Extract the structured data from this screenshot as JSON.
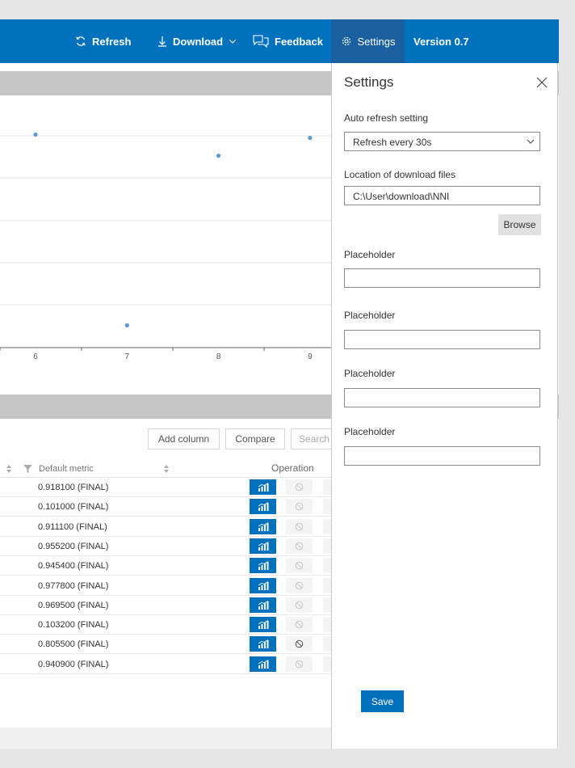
{
  "topbar": {
    "refresh": "Refresh",
    "download": "Download",
    "feedback": "Feedback",
    "settings": "Settings",
    "version": "Version 0.7",
    "color": "#0071bc"
  },
  "chart_data": {
    "type": "scatter",
    "x": [
      6,
      7,
      8,
      9
    ],
    "y": [
      0.955,
      0.1,
      0.86,
      0.94
    ],
    "xticks": [
      "6",
      "7",
      "8",
      "9"
    ],
    "grid": true
  },
  "table": {
    "buttons": [
      "Add column",
      "Compare",
      "Search b"
    ],
    "columns": [
      "Default metric",
      "Operation"
    ],
    "rows": [
      "0.918100 (FINAL)",
      "0.101000 (FINAL)",
      "0.911100 (FINAL)",
      "0.955200 (FINAL)",
      "0.945400 (FINAL)",
      "0.977800 (FINAL)",
      "0.969500 (FINAL)",
      "0.103200 (FINAL)",
      "0.805500 (FINAL)",
      "0.940900 (FINAL)"
    ]
  },
  "settings": {
    "title": "Settings",
    "auto_refresh_label": "Auto refresh setting",
    "auto_refresh_value": "Refresh every 30s",
    "download_location_label": "Location of download files",
    "download_location_value": "C:\\User\\download\\NNI",
    "browse": "Browse",
    "placeholders": [
      "Placeholder",
      "Placeholder",
      "Placeholder",
      "Placeholder"
    ],
    "save": "Save"
  }
}
